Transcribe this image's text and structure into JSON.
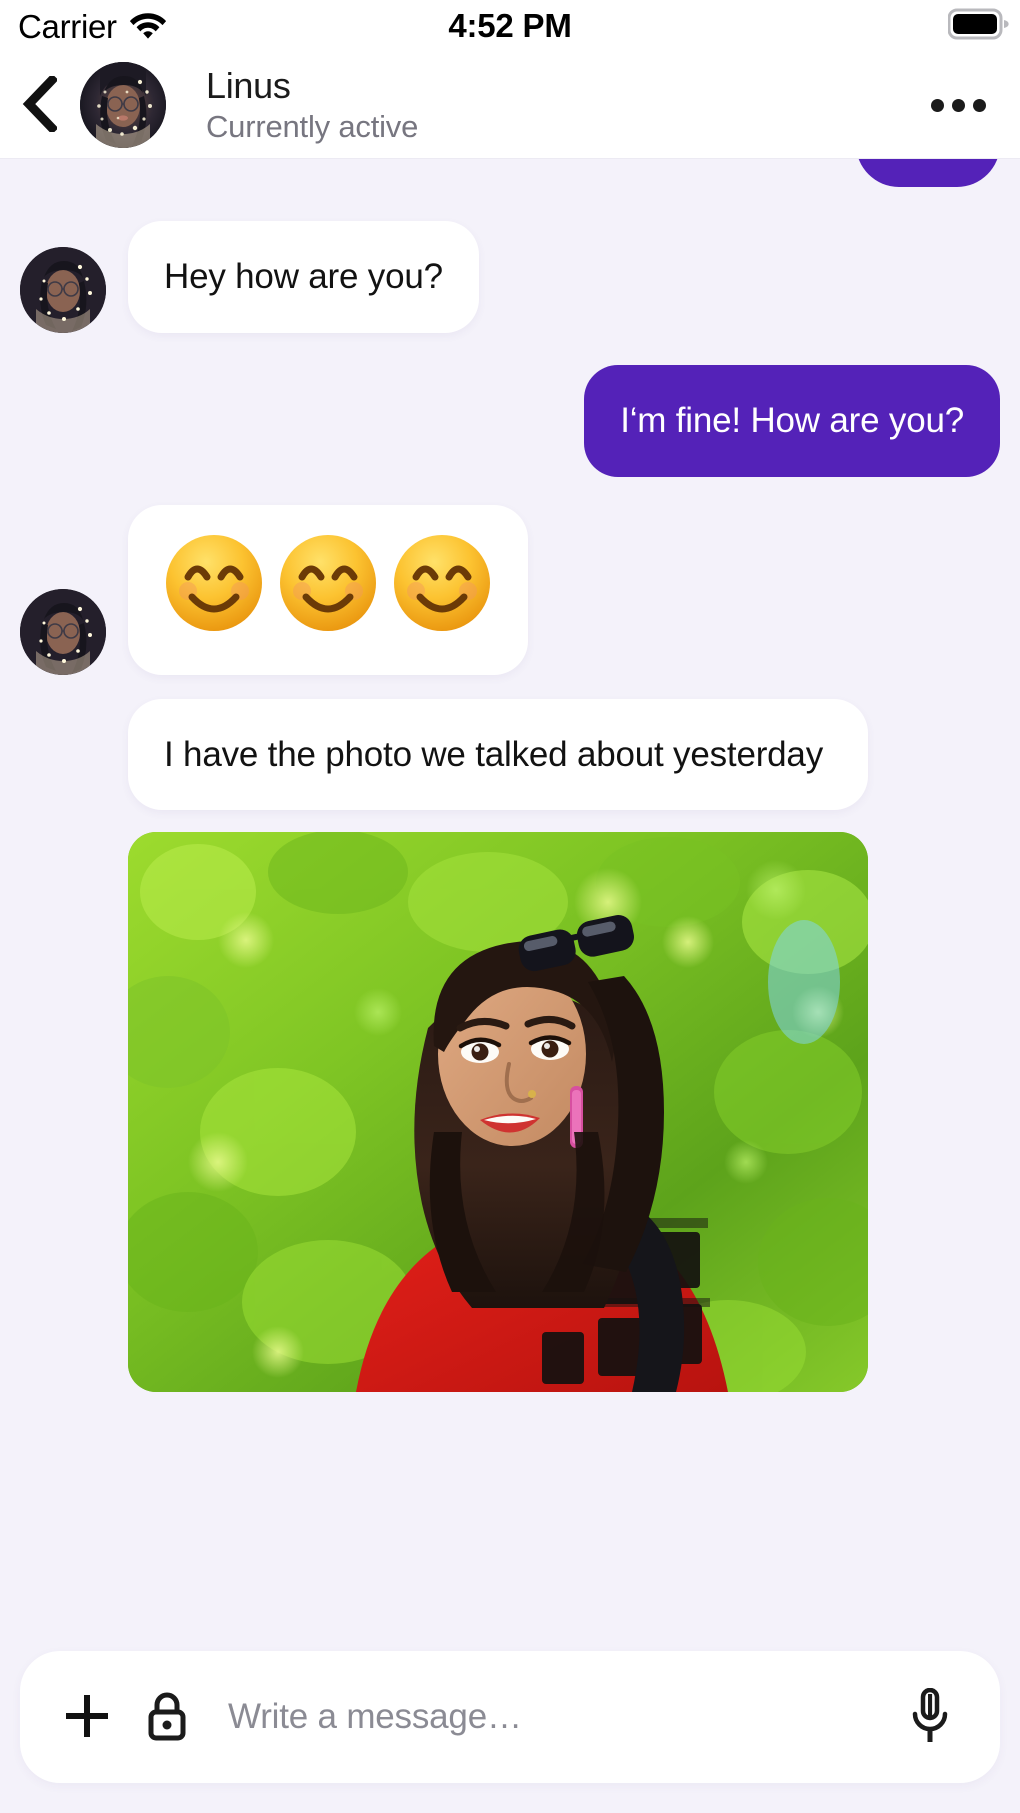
{
  "status_bar": {
    "carrier": "Carrier",
    "wifi_icon": "wifi-icon",
    "time": "4:52 PM",
    "battery_icon": "battery-full-icon"
  },
  "header": {
    "back_icon": "chevron-left-icon",
    "avatar_name": "contact-avatar",
    "contact_name": "Linus",
    "contact_status": "Currently active",
    "more_icon": "ellipsis-icon"
  },
  "conversation": {
    "messages": [
      {
        "id": "m0",
        "type": "text",
        "direction": "outgoing",
        "text": "",
        "clipped": true
      },
      {
        "id": "m1",
        "type": "text",
        "direction": "incoming",
        "text": "Hey how are you?",
        "has_avatar": true
      },
      {
        "id": "m2",
        "type": "text",
        "direction": "outgoing",
        "text": "I‘m fine! How are you?",
        "has_avatar": false
      },
      {
        "id": "m3",
        "type": "emoji",
        "direction": "incoming",
        "emojis": [
          "😊",
          "😊",
          "😊"
        ],
        "emoji_name": "smiling-face-with-smiling-eyes",
        "count": 3,
        "has_avatar": true
      },
      {
        "id": "m4",
        "type": "text",
        "direction": "incoming",
        "text": "I have the photo we talked about yesterday",
        "has_avatar": false
      },
      {
        "id": "m5",
        "type": "image",
        "direction": "incoming",
        "alt": "Photo of a woman in a red plaid shirt with sunglasses on her head, standing in front of green foliage",
        "has_avatar": false
      }
    ]
  },
  "composer": {
    "add_icon": "plus-icon",
    "lock_icon": "lock-closed-icon",
    "placeholder": "Write a message…",
    "value": "",
    "mic_icon": "microphone-icon"
  },
  "colors": {
    "accent_purple": "#5422B8",
    "chat_background": "#F4F2FA",
    "incoming_bubble": "#FFFFFF",
    "incoming_text": "#121212",
    "outgoing_text": "#FFFFFF",
    "header_background": "#FFFFFF",
    "secondary_text": "#777680"
  }
}
